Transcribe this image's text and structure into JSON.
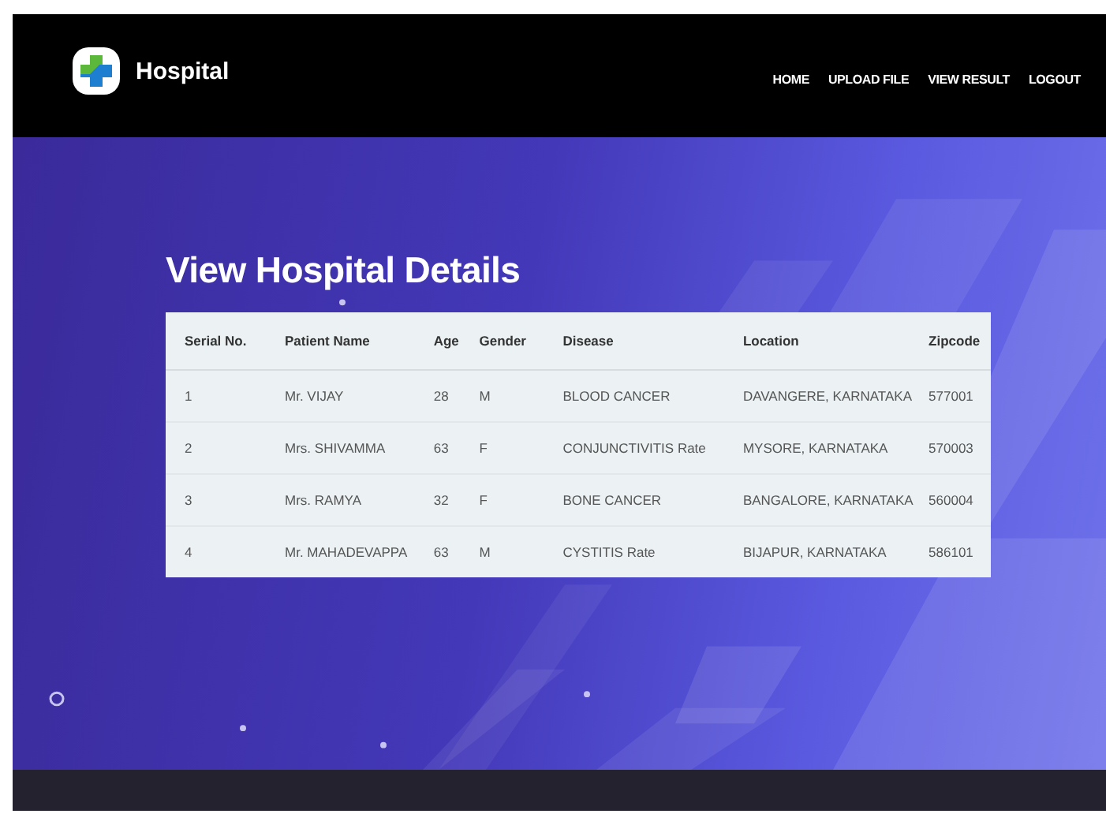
{
  "brand": {
    "name": "Hospital"
  },
  "nav": [
    {
      "label": "HOME"
    },
    {
      "label": "UPLOAD FILE"
    },
    {
      "label": "VIEW RESULT"
    },
    {
      "label": "LOGOUT"
    }
  ],
  "page_title": "View Hospital Details",
  "table": {
    "columns": [
      "Serial No.",
      "Patient Name",
      "Age",
      "Gender",
      "Disease",
      "Location",
      "Zipcode"
    ],
    "rows": [
      [
        "1",
        "Mr. VIJAY",
        "28",
        "M",
        "BLOOD CANCER",
        "DAVANGERE, KARNATAKA",
        "577001"
      ],
      [
        "2",
        "Mrs. SHIVAMMA",
        "63",
        "F",
        "CONJUNCTIVITIS Rate",
        "MYSORE, KARNATAKA",
        "570003"
      ],
      [
        "3",
        "Mrs. RAMYA",
        "32",
        "F",
        "BONE CANCER",
        "BANGALORE, KARNATAKA",
        "560004"
      ],
      [
        "4",
        "Mr. MAHADEVAPPA",
        "63",
        "M",
        "CYSTITIS Rate",
        "BIJAPUR, KARNATAKA",
        "586101"
      ]
    ]
  }
}
